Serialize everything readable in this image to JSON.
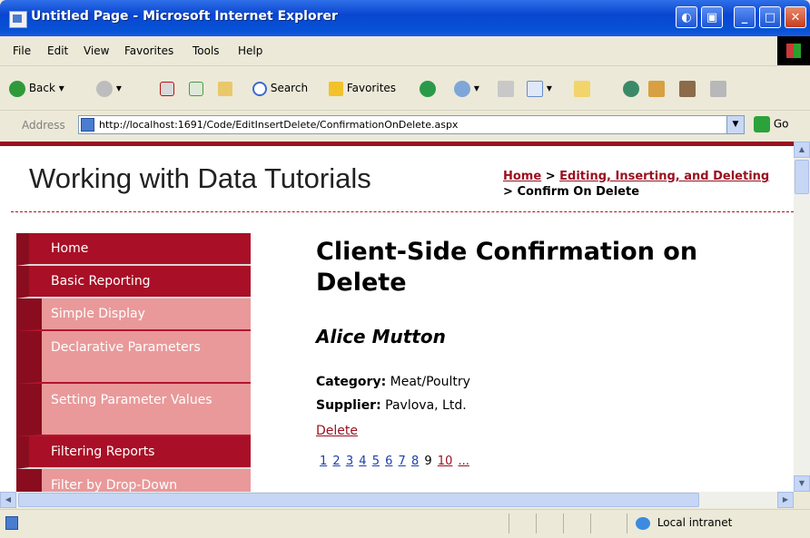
{
  "window": {
    "title": "Untitled Page - Microsoft Internet Explorer"
  },
  "menubar": [
    "File",
    "Edit",
    "View",
    "Favorites",
    "Tools",
    "Help"
  ],
  "toolbar": {
    "back": "Back",
    "search": "Search",
    "favorites": "Favorites"
  },
  "address": {
    "label": "Address",
    "url": "http://localhost:1691/Code/EditInsertDelete/ConfirmationOnDelete.aspx",
    "go": "Go"
  },
  "page": {
    "site_title": "Working with Data Tutorials",
    "breadcrumb": {
      "home": "Home",
      "sep": ">",
      "section": "Editing, Inserting, and Deleting",
      "current": "Confirm On Delete"
    },
    "menu": {
      "home": "Home",
      "basic_reporting": "Basic Reporting",
      "simple_display": "Simple Display",
      "declarative_parameters": "Declarative Parameters",
      "setting_parameter_values": "Setting Parameter Values",
      "filtering_reports": "Filtering Reports",
      "filter_by_dropdown": "Filter by Drop-Down"
    },
    "heading": "Client-Side Confirmation on Delete",
    "product_name": "Alice Mutton",
    "category_label": "Category:",
    "category_value": "Meat/Poultry",
    "supplier_label": "Supplier:",
    "supplier_value": "Pavlova, Ltd.",
    "delete_label": "Delete",
    "pager": [
      "1",
      "2",
      "3",
      "4",
      "5",
      "6",
      "7",
      "8",
      "9",
      "10",
      "..."
    ],
    "current_page": "9"
  },
  "status": {
    "zone": "Local intranet"
  },
  "colors": {
    "accent": "#9a1020",
    "menu_bg": "#a90f26",
    "submenu_bg": "#e9999a"
  }
}
